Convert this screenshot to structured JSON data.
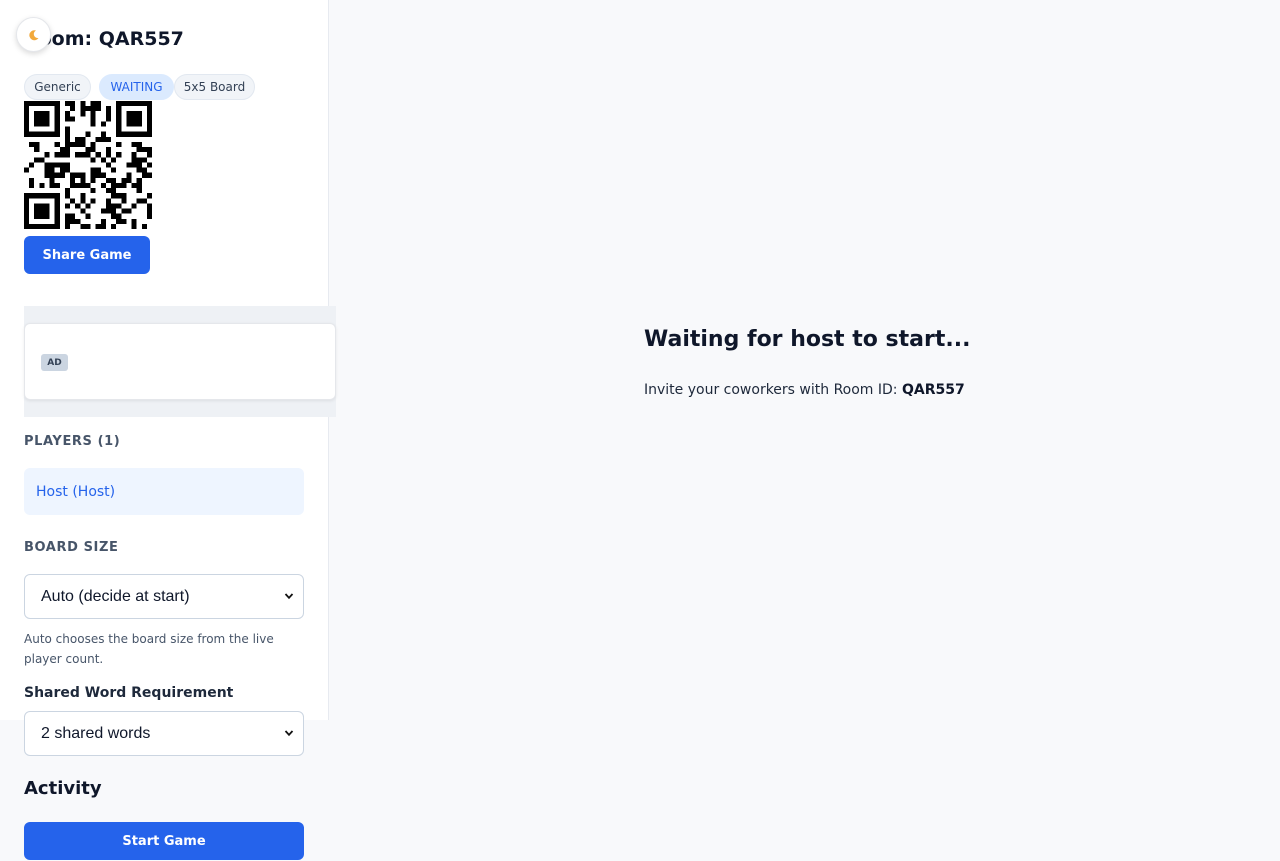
{
  "sidebar": {
    "theme_toggle_icon": "moon-icon",
    "room_title": "Room: QAR557",
    "tags": {
      "category": "Generic",
      "status": "WAITING",
      "board": "5x5 Board"
    },
    "share_button": "Share Game",
    "ad_label": "AD",
    "players": {
      "heading": "PLAYERS (1)",
      "items": [
        "Host (Host)"
      ]
    },
    "board_size": {
      "heading": "BOARD SIZE",
      "selected": "Auto (decide at start)",
      "hint": "Auto chooses the board size from the live player count."
    },
    "shared_words": {
      "heading": "Shared Word Requirement",
      "selected": "2 shared words"
    },
    "activity_heading": "Activity",
    "start_button": "Start Game"
  },
  "main": {
    "title": "Waiting for host to start...",
    "invite_text": "Invite your coworkers with Room ID: ",
    "room_id": "QAR557"
  },
  "colors": {
    "accent": "#2563eb",
    "status_pill_bg": "#dbeafe",
    "player_item_bg": "#eef5ff"
  }
}
